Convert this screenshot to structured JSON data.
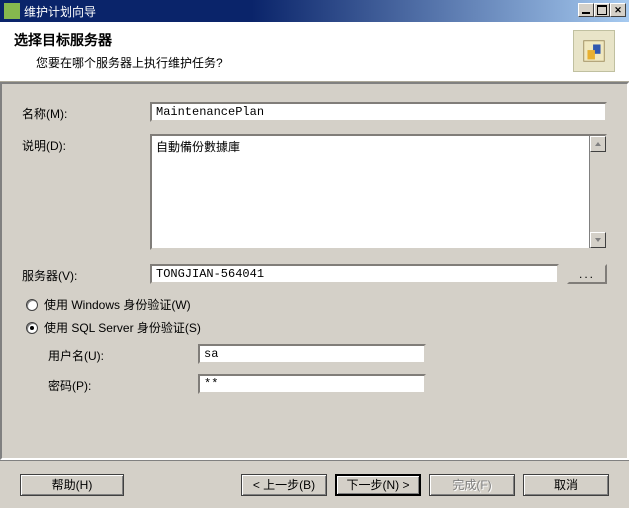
{
  "window": {
    "title": "维护计划向导"
  },
  "header": {
    "heading": "选择目标服务器",
    "subtitle": "您要在哪个服务器上执行维护任务?"
  },
  "form": {
    "name_label": "名称(M):",
    "name_value": "MaintenancePlan",
    "desc_label": "说明(D):",
    "desc_value": "自動備份數據庫",
    "server_label": "服务器(V):",
    "server_value": "TONGJIAN-564041",
    "browse_label": "...",
    "auth_windows_label": "使用 Windows 身份验证(W)",
    "auth_sql_label": "使用 SQL Server 身份验证(S)",
    "auth_selected": "sql",
    "user_label": "用户名(U):",
    "user_value": "sa",
    "pass_label": "密码(P):",
    "pass_value": "**"
  },
  "footer": {
    "help": "帮助(H)",
    "back": "< 上一步(B)",
    "next": "下一步(N) >",
    "finish": "完成(F)",
    "cancel": "取消"
  }
}
